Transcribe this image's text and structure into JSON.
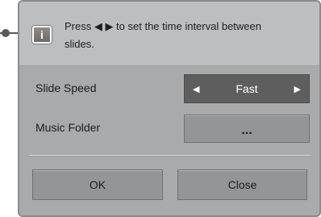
{
  "dialog": {
    "info": {
      "icon": "info-icon",
      "icon_glyph": "i",
      "message": "Press ◀ ▶ to set the time interval between slides."
    },
    "slide_speed": {
      "label": "Slide Speed",
      "value": "Fast",
      "left_arrow": "◀",
      "right_arrow": "▶"
    },
    "music_folder": {
      "label": "Music Folder",
      "button_label": "..."
    },
    "buttons": {
      "ok": "OK",
      "close": "Close"
    }
  },
  "colors": {
    "panel": "#a9aaab",
    "info_bar": "#bdbebf",
    "selected_control": "#5e5e5e",
    "button": "#949596"
  }
}
